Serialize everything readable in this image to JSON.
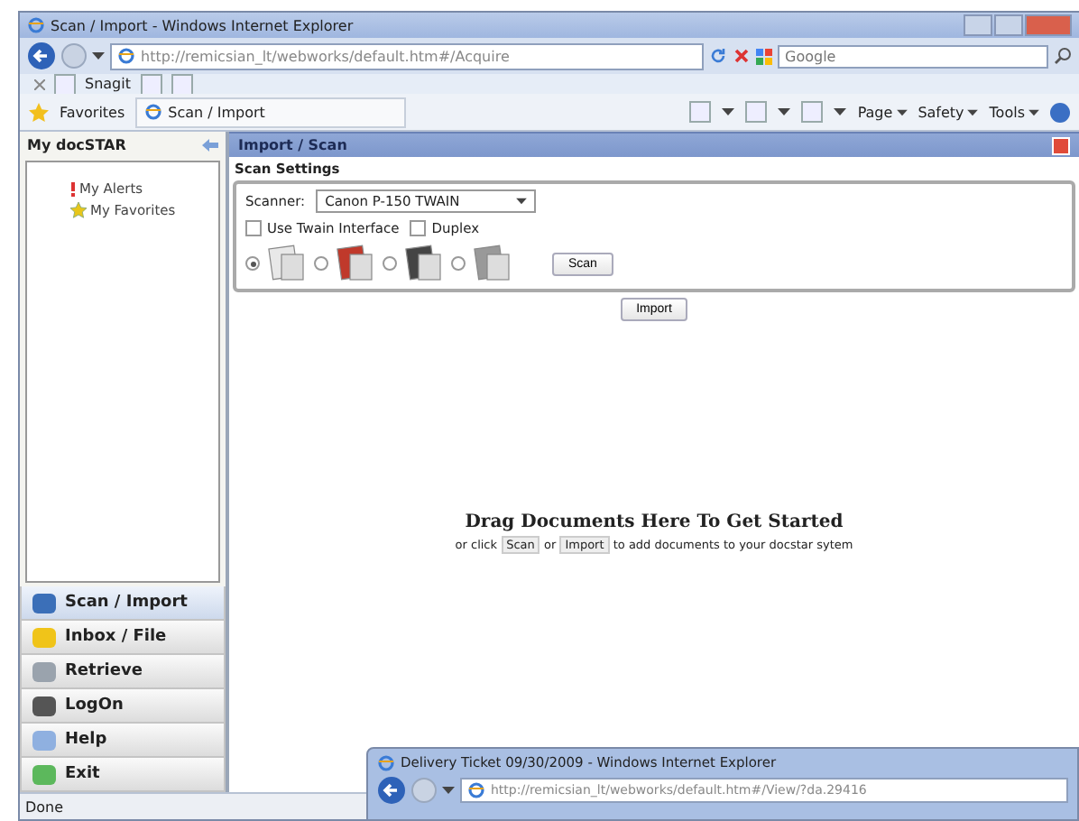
{
  "window": {
    "title": "Scan / Import - Windows Internet Explorer",
    "address": "http://remicsian_lt/webworks/default.htm#/Acquire",
    "search_placeholder": "Google"
  },
  "links_bar": {
    "items": [
      "Snagit"
    ]
  },
  "favorites_bar": {
    "favorites": "Favorites",
    "tab": "Scan / Import",
    "menus": [
      "Page",
      "Safety",
      "Tools"
    ]
  },
  "sidebar": {
    "title": "My docSTAR",
    "tree": [
      {
        "label": "My Alerts",
        "kind": "alert"
      },
      {
        "label": "My Favorites",
        "kind": "star"
      }
    ],
    "nav": [
      {
        "label": "Scan / Import",
        "selected": true
      },
      {
        "label": "Inbox / File",
        "selected": false
      },
      {
        "label": "Retrieve",
        "selected": false
      },
      {
        "label": "LogOn",
        "selected": false
      },
      {
        "label": "Help",
        "selected": false
      },
      {
        "label": "Exit",
        "selected": false
      }
    ]
  },
  "panel": {
    "title": "Import / Scan",
    "section": "Scan Settings",
    "scanner_label": "Scanner:",
    "scanner_value": "Canon P-150 TWAIN",
    "options": [
      {
        "label": "Use Twain Interface",
        "checked": false
      },
      {
        "label": "Duplex",
        "checked": false
      }
    ],
    "modes": [
      {
        "selected": true
      },
      {
        "selected": false
      },
      {
        "selected": false
      },
      {
        "selected": false
      }
    ],
    "scan_button": "Scan",
    "import_button": "Import",
    "drop_title": "Drag Documents Here To Get Started",
    "drop_hint": [
      {
        "kind": "text",
        "text": "or click"
      },
      {
        "kind": "button",
        "text": "Scan"
      },
      {
        "kind": "text",
        "text": "or"
      },
      {
        "kind": "button",
        "text": "Import"
      },
      {
        "kind": "text",
        "text": "to add documents to your docstar sytem"
      }
    ]
  },
  "status_bar": "Done",
  "popup": {
    "title": "Delivery Ticket 09/30/2009 - Windows Internet Explorer",
    "address": "http://remicsian_lt/webworks/default.htm#/View/?da.29416"
  }
}
